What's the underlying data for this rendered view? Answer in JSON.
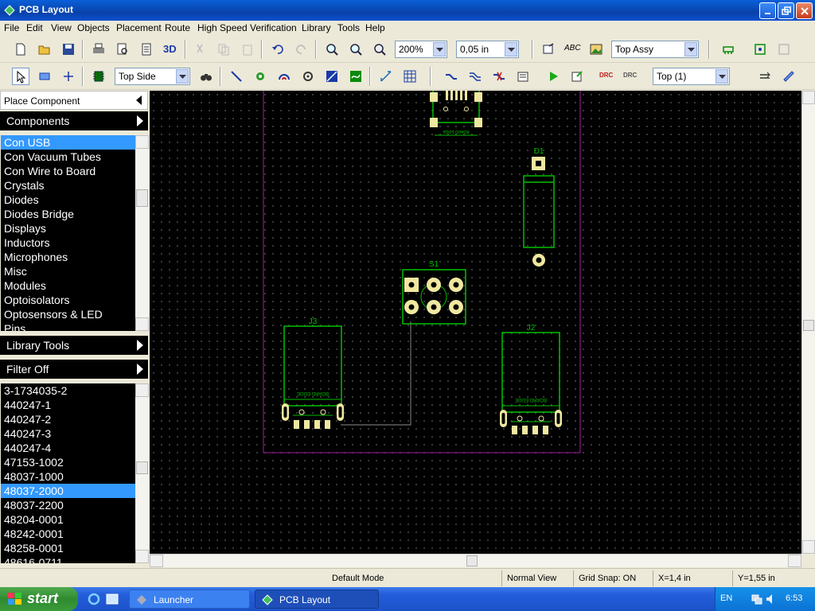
{
  "window": {
    "title": "PCB Layout"
  },
  "menu": [
    "File",
    "Edit",
    "View",
    "Objects",
    "Placement",
    "Route",
    "High Speed",
    "Verification",
    "Library",
    "Tools",
    "Help"
  ],
  "toolbar1": {
    "three_d_label": "3D",
    "zoom_value": "200%",
    "grid_value": "0,05 in",
    "assy_layer": "Top Assy"
  },
  "toolbar2": {
    "side_value": "Top Side",
    "layer_value": "Top (1)"
  },
  "panel": {
    "title": "Place Component",
    "components_header": "Components",
    "categories": [
      "Con USB",
      "Con Vacuum Tubes",
      "Con Wire to Board",
      "Crystals",
      "Diodes",
      "Diodes Bridge",
      "Displays",
      "Inductors",
      "Microphones",
      "Misc",
      "Modules",
      "Optoisolators",
      "Optosensors & LED",
      "Pins"
    ],
    "selected_category": "Con USB",
    "library_tools": "Library Tools",
    "filter": "Filter Off",
    "parts": [
      "3-1734035-2",
      "440247-1",
      "440247-2",
      "440247-3",
      "440247-4",
      "47153-1002",
      "48037-1000",
      "48037-2000",
      "48037-2200",
      "48204-0001",
      "48242-0001",
      "48258-0001",
      "48616-0711"
    ],
    "selected_part": "48037-2000"
  },
  "board": {
    "refdes": {
      "d1": "D1",
      "s1": "S1",
      "j3": "J3",
      "j2": "J2"
    },
    "board_edge_text": "BOARD EDGE"
  },
  "status": {
    "mode": "Default Mode",
    "view": "Normal View",
    "grid_snap": "Grid Snap: ON",
    "x": "X=1,4 in",
    "y": "Y=1,55 in"
  },
  "taskbar": {
    "start": "start",
    "tasks": [
      "Launcher",
      "PCB Layout"
    ],
    "lang": "EN",
    "clock": "6:53"
  },
  "colors": {
    "outline": "#00c000",
    "pad": "#f0e8a0",
    "board_border": "#a020a0",
    "selection": "#3399ff",
    "titlebar": "#0842a8"
  }
}
